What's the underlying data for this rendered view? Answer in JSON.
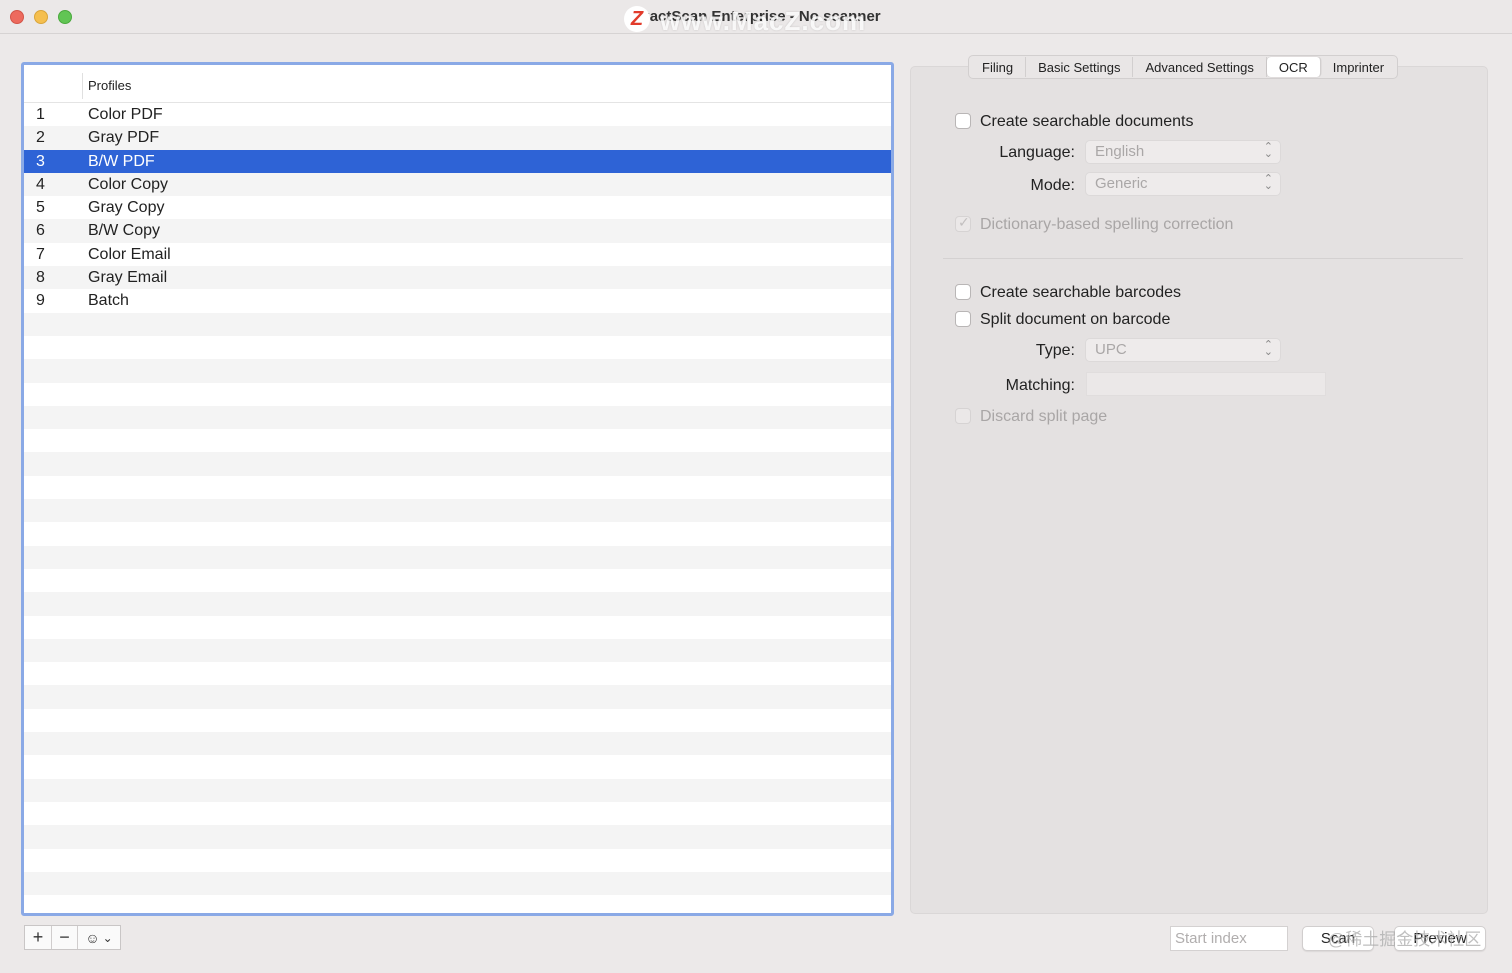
{
  "window": {
    "title": "ExactScan Enterprise - No scanner",
    "watermark": "www.MacZ.com",
    "watermark_logo": "Z"
  },
  "profiles": {
    "header": "Profiles",
    "rows": [
      {
        "num": "1",
        "name": "Color PDF"
      },
      {
        "num": "2",
        "name": "Gray PDF"
      },
      {
        "num": "3",
        "name": "B/W PDF",
        "selected": true
      },
      {
        "num": "4",
        "name": "Color Copy"
      },
      {
        "num": "5",
        "name": "Gray Copy"
      },
      {
        "num": "6",
        "name": "B/W Copy"
      },
      {
        "num": "7",
        "name": "Color Email"
      },
      {
        "num": "8",
        "name": "Gray Email"
      },
      {
        "num": "9",
        "name": "Batch"
      }
    ],
    "toolbar": {
      "add": "+",
      "remove": "−",
      "action": "☺",
      "action_chevron": "⌄"
    }
  },
  "tabs": [
    {
      "label": "Filing"
    },
    {
      "label": "Basic Settings"
    },
    {
      "label": "Advanced Settings"
    },
    {
      "label": "OCR",
      "active": true
    },
    {
      "label": "Imprinter"
    }
  ],
  "ocr": {
    "create_searchable_documents": "Create searchable documents",
    "language_label": "Language:",
    "language_value": "English",
    "mode_label": "Mode:",
    "mode_value": "Generic",
    "dictionary_spelling": "Dictionary-based spelling correction",
    "create_searchable_barcodes": "Create searchable barcodes",
    "split_on_barcode": "Split document on barcode",
    "type_label": "Type:",
    "type_value": "UPC",
    "matching_label": "Matching:",
    "discard_split_page": "Discard split page"
  },
  "footer": {
    "start_index_placeholder": "Start index",
    "scan_label": "Scan",
    "preview_label": "Preview",
    "watermark": "@稀土掘金技术社区"
  },
  "colors": {
    "selection": "#2e63d6",
    "focus_ring": "#8aa9e6"
  }
}
